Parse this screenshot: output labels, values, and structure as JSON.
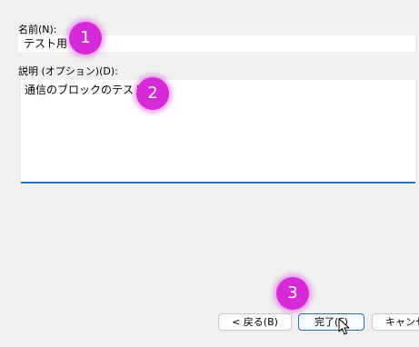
{
  "name_field": {
    "label": "名前(N):",
    "value": "テスト用"
  },
  "description_field": {
    "label": "説明 (オプション)(D):",
    "value": "通信のブロックのテスト"
  },
  "buttons": {
    "back": "< 戻る(B)",
    "finish": "完了(F)",
    "cancel": "キャンセル"
  },
  "annotations": [
    "1",
    "2",
    "3"
  ],
  "colors": {
    "badge": "#d62ad9",
    "focus_border": "#2a6fb0",
    "window_bg": "#f0f0f0"
  }
}
